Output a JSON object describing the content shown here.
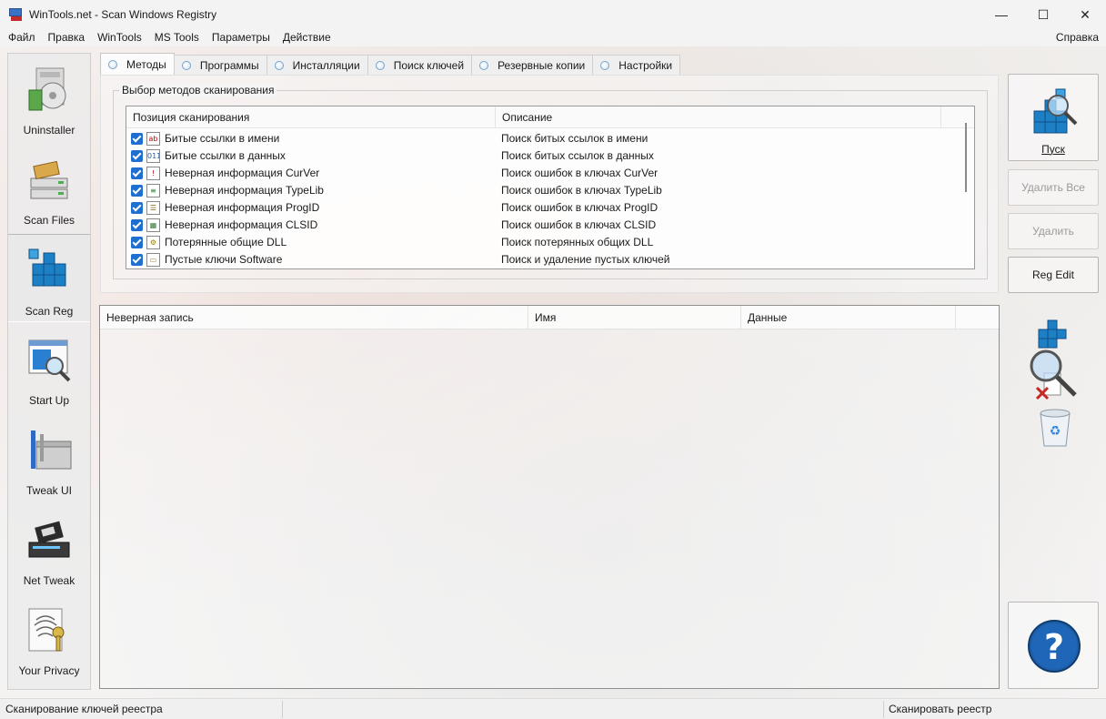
{
  "window": {
    "title": "WinTools.net - Scan Windows Registry",
    "minimize": "—",
    "maximize": "☐",
    "close": "✕"
  },
  "menu": {
    "items": [
      "Файл",
      "Правка",
      "WinTools",
      "MS Tools",
      "Параметры",
      "Действие"
    ],
    "help": "Справка"
  },
  "sidebar": {
    "items": [
      {
        "label": "Uninstaller",
        "icon": "uninstaller-icon"
      },
      {
        "label": "Scan Files",
        "icon": "scan-files-icon"
      },
      {
        "label": "Scan Reg",
        "icon": "scan-reg-icon"
      },
      {
        "label": "Start Up",
        "icon": "startup-icon"
      },
      {
        "label": "Tweak UI",
        "icon": "tweak-ui-icon"
      },
      {
        "label": "Net Tweak",
        "icon": "net-tweak-icon"
      },
      {
        "label": "Your Privacy",
        "icon": "privacy-icon"
      }
    ],
    "active_index": 2
  },
  "tabs": [
    {
      "label": "Методы"
    },
    {
      "label": "Программы"
    },
    {
      "label": "Инсталляции"
    },
    {
      "label": "Поиск ключей"
    },
    {
      "label": "Резервные копии"
    },
    {
      "label": "Настройки"
    }
  ],
  "methods": {
    "group_title": "Выбор методов сканирования",
    "columns": [
      "Позиция сканирования",
      "Описание"
    ],
    "rows": [
      {
        "name": "Битые ссылки в имени",
        "desc": "Поиск битых ссылок в имени",
        "icon": "ab",
        "checked": true
      },
      {
        "name": "Битые ссылки в данных",
        "desc": "Поиск битых ссылок в данных",
        "icon": "011",
        "checked": true
      },
      {
        "name": "Неверная информация CurVer",
        "desc": "Поиск ошибок в ключах CurVer",
        "icon": "!",
        "checked": true
      },
      {
        "name": "Неверная информация TypeLib",
        "desc": "Поиск ошибок в ключах TypeLib",
        "icon": "≡",
        "checked": true
      },
      {
        "name": "Неверная информация ProgID",
        "desc": "Поиск ошибок в ключах ProgID",
        "icon": "☰",
        "checked": true
      },
      {
        "name": "Неверная информация CLSID",
        "desc": "Поиск ошибок в ключах CLSID",
        "icon": "▦",
        "checked": true
      },
      {
        "name": "Потерянные общие DLL",
        "desc": "Поиск потерянных общих DLL",
        "icon": "⚙",
        "checked": true
      },
      {
        "name": "Пустые ключи Software",
        "desc": "Поиск и удаление пустых ключей",
        "icon": "▭",
        "checked": true
      }
    ]
  },
  "results": {
    "columns": [
      "Неверная запись",
      "Имя",
      "Данные"
    ]
  },
  "actions": {
    "start": "Пуск",
    "delete_all": "Удалить Все",
    "delete": "Удалить",
    "reg_edit": "Reg Edit"
  },
  "status": {
    "left": "Сканирование ключей реестра",
    "right": "Сканировать реестр"
  },
  "colors": {
    "accent": "#1f6fd0",
    "help_blue": "#1f5fa8"
  }
}
